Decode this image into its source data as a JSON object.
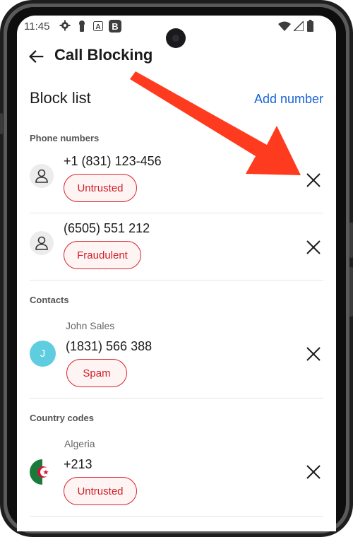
{
  "status_bar": {
    "time": "11:45",
    "left_icons": [
      "gear-icon",
      "keyhole-icon",
      "a-badge-icon",
      "b-badge-icon"
    ],
    "right_icons": [
      "wifi-icon",
      "signal-icon",
      "battery-icon"
    ]
  },
  "app_bar": {
    "title": "Call Blocking",
    "back_icon": "arrow-back-icon"
  },
  "header": {
    "title": "Block list",
    "add_number_label": "Add number"
  },
  "sections": {
    "phone_numbers": {
      "label": "Phone numbers",
      "items": [
        {
          "number": "+1 (831) 123-456",
          "badge": "Untrusted"
        },
        {
          "number": "(6505) 551 212",
          "badge": "Fraudulent"
        }
      ]
    },
    "contacts": {
      "label": "Contacts",
      "items": [
        {
          "name": "John Sales",
          "initial": "J",
          "number": "(1831) 566 388",
          "badge": "Spam"
        }
      ]
    },
    "country_codes": {
      "label": "Country codes",
      "items": [
        {
          "name": "Algeria",
          "code": "+213",
          "badge": "Untrusted",
          "flag": "algeria-flag-icon"
        }
      ]
    }
  },
  "colors": {
    "accent": "#1a63d8",
    "badge_text": "#cf1f26",
    "badge_bg": "#fff4f4",
    "avatar_teal": "#5fcde0",
    "annotation_arrow": "#ff3b1f"
  }
}
